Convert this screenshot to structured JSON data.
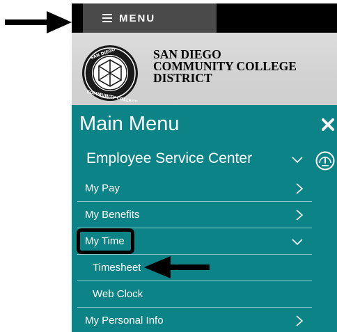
{
  "topbar": {
    "menu_label": "MENU"
  },
  "header": {
    "org_line1": "SAN DIEGO",
    "org_line2": "COMMUNITY COLLEGE",
    "org_line3": "DISTRICT"
  },
  "main_menu": {
    "title": "Main Menu",
    "section_label": "Employee Service Center",
    "items": [
      {
        "label": "My Pay",
        "indicator": "chevron-right"
      },
      {
        "label": "My Benefits",
        "indicator": "chevron-right"
      },
      {
        "label": "My Time",
        "indicator": "chevron-down"
      },
      {
        "label": "Timesheet",
        "indicator": "none"
      },
      {
        "label": "Web Clock",
        "indicator": "none"
      },
      {
        "label": "My Personal Info",
        "indicator": "chevron-right"
      }
    ]
  },
  "colors": {
    "panel_teal": "#0b8387",
    "topbar_black": "#000000",
    "menu_button_gray": "#4a4a4a",
    "logo_band_gray": "#d4d4d4"
  },
  "icons": {
    "menu": "hamburger-icon",
    "close": "close-icon",
    "dashboard": "dashboard-icon",
    "section_toggle": "chevron-down-icon"
  }
}
